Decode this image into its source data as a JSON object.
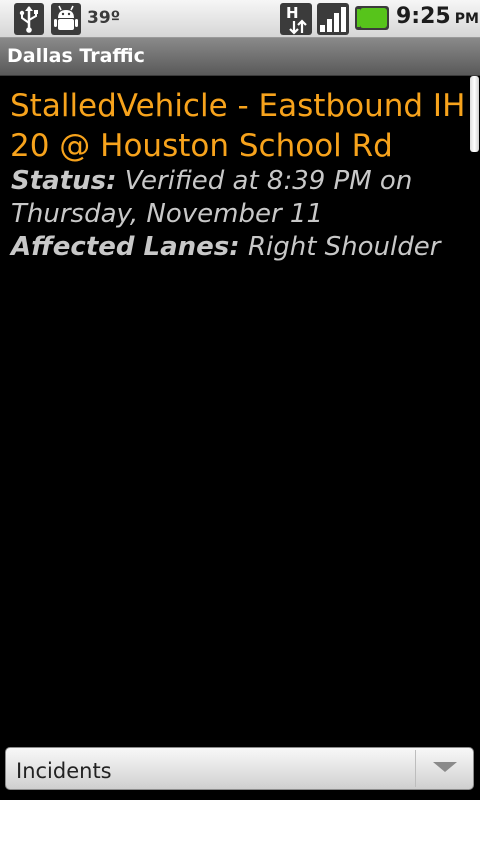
{
  "status_bar": {
    "temperature": "39º",
    "time": "9:25",
    "ampm": "PM",
    "icons": [
      "usb-icon",
      "debug-icon",
      "hspa-data-icon",
      "signal-icon",
      "battery-icon"
    ],
    "battery_color": "#57c41b"
  },
  "app": {
    "title": "Dallas Traffic"
  },
  "incident": {
    "headline": "StalledVehicle - Eastbound IH 20 @ Houston School Rd",
    "status_label": "Status:",
    "status_value": "Verified at 8:39 PM on Thursday, November 11",
    "lanes_label": "Affected Lanes:",
    "lanes_value": "Right Shoulder"
  },
  "spinner": {
    "selected": "Incidents"
  },
  "colors": {
    "headline": "#f7a31c",
    "detail_text": "#c8c8c8",
    "background": "#000000"
  }
}
